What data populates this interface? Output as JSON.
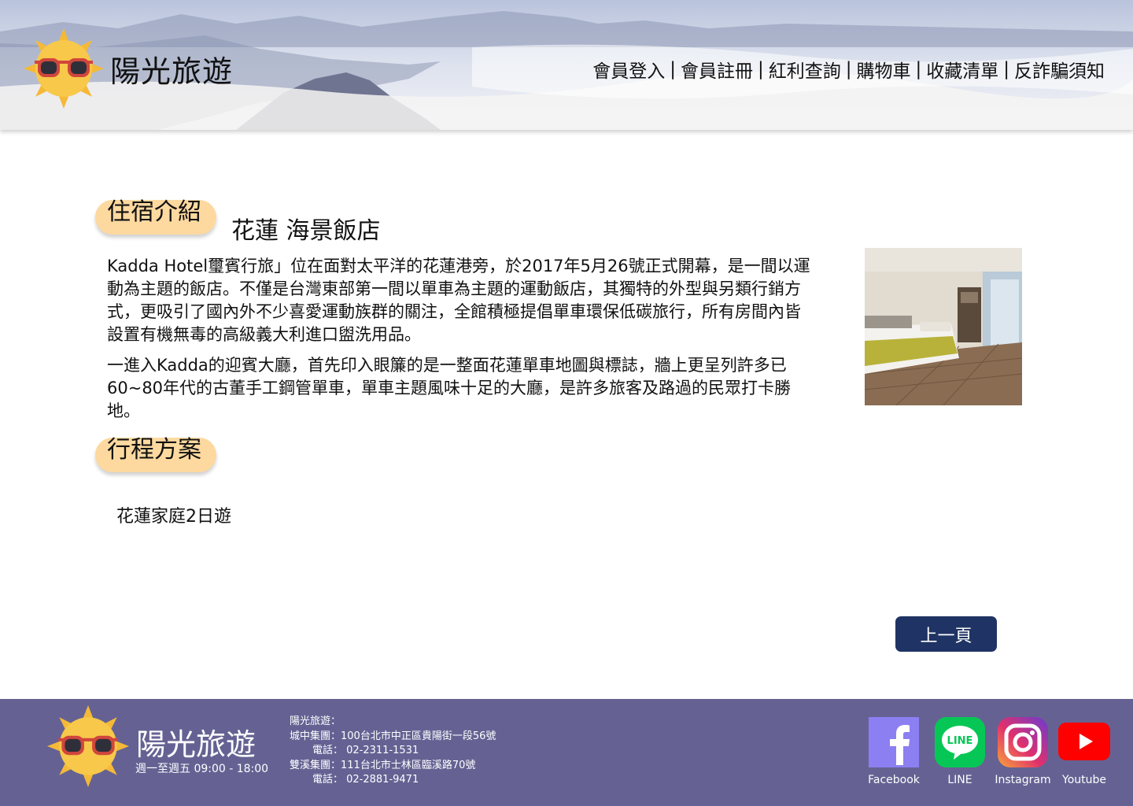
{
  "header": {
    "site_title": "陽光旅遊",
    "nav": [
      "會員登入",
      "會員註冊",
      "紅利查詢",
      "購物車",
      "收藏清單",
      "反詐騙須知"
    ],
    "separator": "|"
  },
  "accommodation": {
    "section_label": "住宿介紹",
    "hotel_name": "花蓮 海景飯店",
    "paragraphs": [
      "Kadda Hotel璽賓行旅」位在面對太平洋的花蓮港旁，於2017年5月26號正式開幕，是一間以運動為主題的飯店。不僅是台灣東部第一間以單車為主題的運動飯店，其獨特的外型與另類行銷方式，更吸引了國內外不少喜愛運動族群的關注，全館積極提倡單車環保低碳旅行，所有房間內皆設置有機無毒的高級義大利進口盥洗用品。",
      "一進入Kadda的迎賓大廳，首先印入眼簾的是一整面花蓮單車地圖與標誌，牆上更呈列許多已60~80年代的古董手工鋼管單車，單車主題風味十足的大廳，是許多旅客及路過的民眾打卡勝地。"
    ]
  },
  "itinerary": {
    "section_label": "行程方案",
    "items": [
      "花蓮家庭2日遊"
    ]
  },
  "back_button": "上一頁",
  "footer": {
    "title": "陽光旅遊",
    "hours": "週一至週五 09:00 - 18:00",
    "info": [
      "陽光旅遊：",
      "城中集團：100台北市中正區貴陽街一段56號",
      "電話： 02-2311-1531",
      "雙溪集團：111台北市士林區臨溪路70號",
      "電話： 02-2881-9471"
    ],
    "social": [
      {
        "label": "Facebook",
        "icon": "facebook-icon",
        "color": "#8c7ff2"
      },
      {
        "label": "LINE",
        "icon": "line-icon",
        "color": "#06c755"
      },
      {
        "label": "Instagram",
        "icon": "instagram-icon",
        "color": "#d62976"
      },
      {
        "label": "Youtube",
        "icon": "youtube-icon",
        "color": "#ff0000"
      }
    ]
  },
  "colors": {
    "tag_bg": "#fdd9a0",
    "button_bg": "#1f3464",
    "footer_bg": "#656293"
  }
}
